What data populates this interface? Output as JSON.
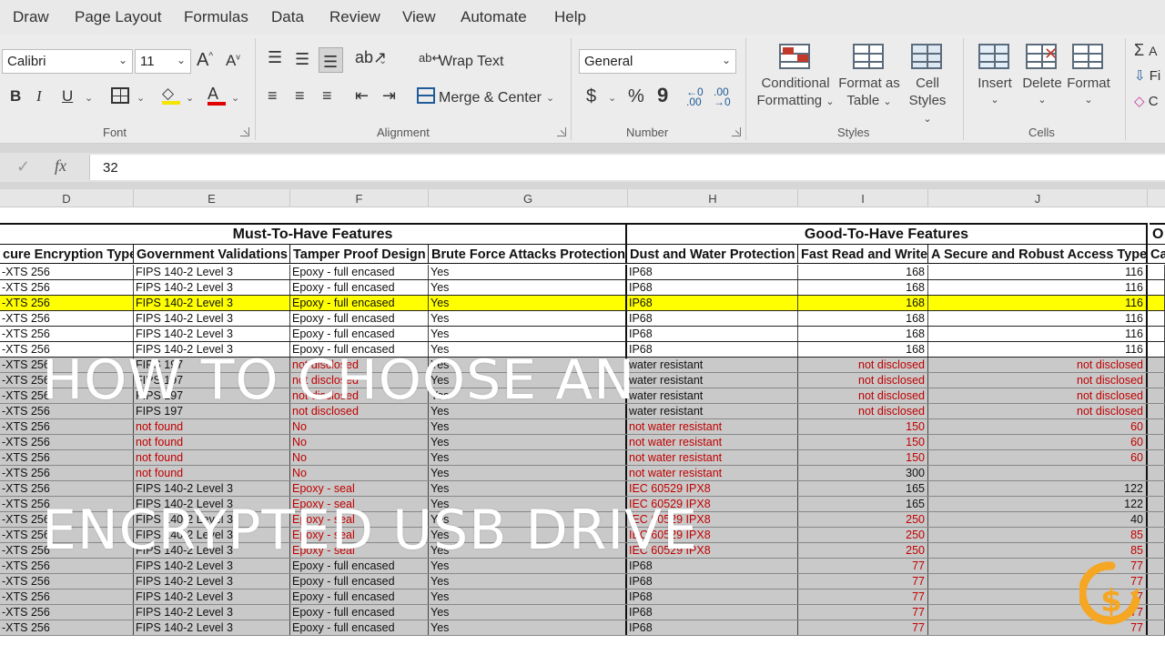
{
  "menu": [
    "Draw",
    "Page Layout",
    "Formulas",
    "Data",
    "Review",
    "View",
    "Automate",
    "Help"
  ],
  "ribbon": {
    "font": {
      "name": "Calibri",
      "size": "11",
      "grow": "A",
      "shrink": "A",
      "bold": "B",
      "italic": "I",
      "underline": "U",
      "color_letter": "A",
      "label": "Font"
    },
    "alignment": {
      "wrap_text": "Wrap Text",
      "merge_center": "Merge & Center",
      "label": "Alignment"
    },
    "number": {
      "format": "General",
      "currency": "$",
      "percent": "%",
      "comma": "9",
      "inc_decimal": ".00",
      "dec_decimal": ".00",
      "label": "Number"
    },
    "styles": {
      "conditional_1": "Conditional",
      "conditional_2": "Formatting",
      "format_table_1": "Format as",
      "format_table_2": "Table",
      "cell_styles_1": "Cell",
      "cell_styles_2": "Styles",
      "label": "Styles"
    },
    "cells": {
      "insert": "Insert",
      "delete": "Delete",
      "format": "Format",
      "label": "Cells"
    },
    "editing": {
      "sum": "A",
      "fill": "Fi",
      "clear": "C"
    }
  },
  "formula_bar": {
    "check": "✓",
    "fx": "fx",
    "value": "32"
  },
  "columns": [
    "D",
    "E",
    "F",
    "G",
    "H",
    "I",
    "J"
  ],
  "group_headers": {
    "must": "Must-To-Have Features",
    "good": "Good-To-Have Features",
    "other": "O"
  },
  "headers": [
    "cure Encryption Type",
    "Government Validations",
    "Tamper Proof Design",
    "Brute Force Attacks Protection",
    "Dust and Water Protection",
    "Fast Read and Write",
    "A Secure and Robust Access Type",
    "Ca"
  ],
  "rows": [
    [
      "-XTS 256",
      "FIPS 140-2 Level 3",
      "Epoxy - full encased",
      "Yes",
      "IP68",
      "168",
      "116"
    ],
    [
      "-XTS 256",
      "FIPS 140-2 Level 3",
      "Epoxy - full encased",
      "Yes",
      "IP68",
      "168",
      "116"
    ],
    [
      "-XTS 256",
      "FIPS 140-2 Level 3",
      "Epoxy - full encased",
      "Yes",
      "IP68",
      "168",
      "116"
    ],
    [
      "-XTS 256",
      "FIPS 140-2 Level 3",
      "Epoxy - full encased",
      "Yes",
      "IP68",
      "168",
      "116"
    ],
    [
      "-XTS 256",
      "FIPS 140-2 Level 3",
      "Epoxy - full encased",
      "Yes",
      "IP68",
      "168",
      "116"
    ],
    [
      "-XTS 256",
      "FIPS 140-2 Level 3",
      "Epoxy - full encased",
      "Yes",
      "IP68",
      "168",
      "116"
    ],
    [
      "-XTS 256",
      "FIPS 197",
      "not disclosed",
      "Yes",
      "water resistant",
      "not disclosed",
      "not disclosed"
    ],
    [
      "-XTS 256",
      "FIPS 197",
      "not disclosed",
      "Yes",
      "water resistant",
      "not disclosed",
      "not disclosed"
    ],
    [
      "-XTS 256",
      "FIPS 197",
      "not disclosed",
      "Yes",
      "water resistant",
      "not disclosed",
      "not disclosed"
    ],
    [
      "-XTS 256",
      "FIPS 197",
      "not disclosed",
      "Yes",
      "water resistant",
      "not disclosed",
      "not disclosed"
    ],
    [
      "-XTS 256",
      "not found",
      "No",
      "Yes",
      "not water resistant",
      "150",
      "60"
    ],
    [
      "-XTS 256",
      "not found",
      "No",
      "Yes",
      "not water resistant",
      "150",
      "60"
    ],
    [
      "-XTS 256",
      "not found",
      "No",
      "Yes",
      "not water resistant",
      "150",
      "60"
    ],
    [
      "-XTS 256",
      "not found",
      "No",
      "Yes",
      "not water resistant",
      "300",
      ""
    ],
    [
      "-XTS 256",
      "FIPS 140-2 Level 3",
      "Epoxy - seal",
      "Yes",
      "IEC 60529 IPX8",
      "165",
      "122"
    ],
    [
      "-XTS 256",
      "FIPS 140-2 Level 3",
      "Epoxy - seal",
      "Yes",
      "IEC 60529 IPX8",
      "165",
      "122"
    ],
    [
      "-XTS 256",
      "FIPS 140-2 Level 3",
      "Epoxy - seal",
      "Yes",
      "IEC 60529 IPX8",
      "250",
      "40"
    ],
    [
      "-XTS 256",
      "FIPS 140-2 Level 3",
      "Epoxy - seal",
      "Yes",
      "IEC 60529 IPX8",
      "250",
      "85"
    ],
    [
      "-XTS 256",
      "FIPS 140-2 Level 3",
      "Epoxy - seal",
      "Yes",
      "IEC 60529 IPX8",
      "250",
      "85"
    ],
    [
      "-XTS 256",
      "FIPS 140-2 Level 3",
      "Epoxy - full encased",
      "Yes",
      "IP68",
      "77",
      "77"
    ],
    [
      "-XTS 256",
      "FIPS 140-2 Level 3",
      "Epoxy - full encased",
      "Yes",
      "IP68",
      "77",
      "77"
    ],
    [
      "-XTS 256",
      "FIPS 140-2 Level 3",
      "Epoxy - full encased",
      "Yes",
      "IP68",
      "77",
      "77"
    ],
    [
      "-XTS 256",
      "FIPS 140-2 Level 3",
      "Epoxy - full encased",
      "Yes",
      "IP68",
      "77",
      "77"
    ],
    [
      "-XTS 256",
      "FIPS 140-2 Level 3",
      "Epoxy - full encased",
      "Yes",
      "IP68",
      "77",
      "77"
    ]
  ],
  "overlay": {
    "line1": "HOW TO CHOOSE AN",
    "line2": "ENCRYPTED USB DRIVE"
  },
  "colors": {
    "highlight": "#ffff00",
    "red_text": "#c00000",
    "logo": "#f5a623"
  }
}
